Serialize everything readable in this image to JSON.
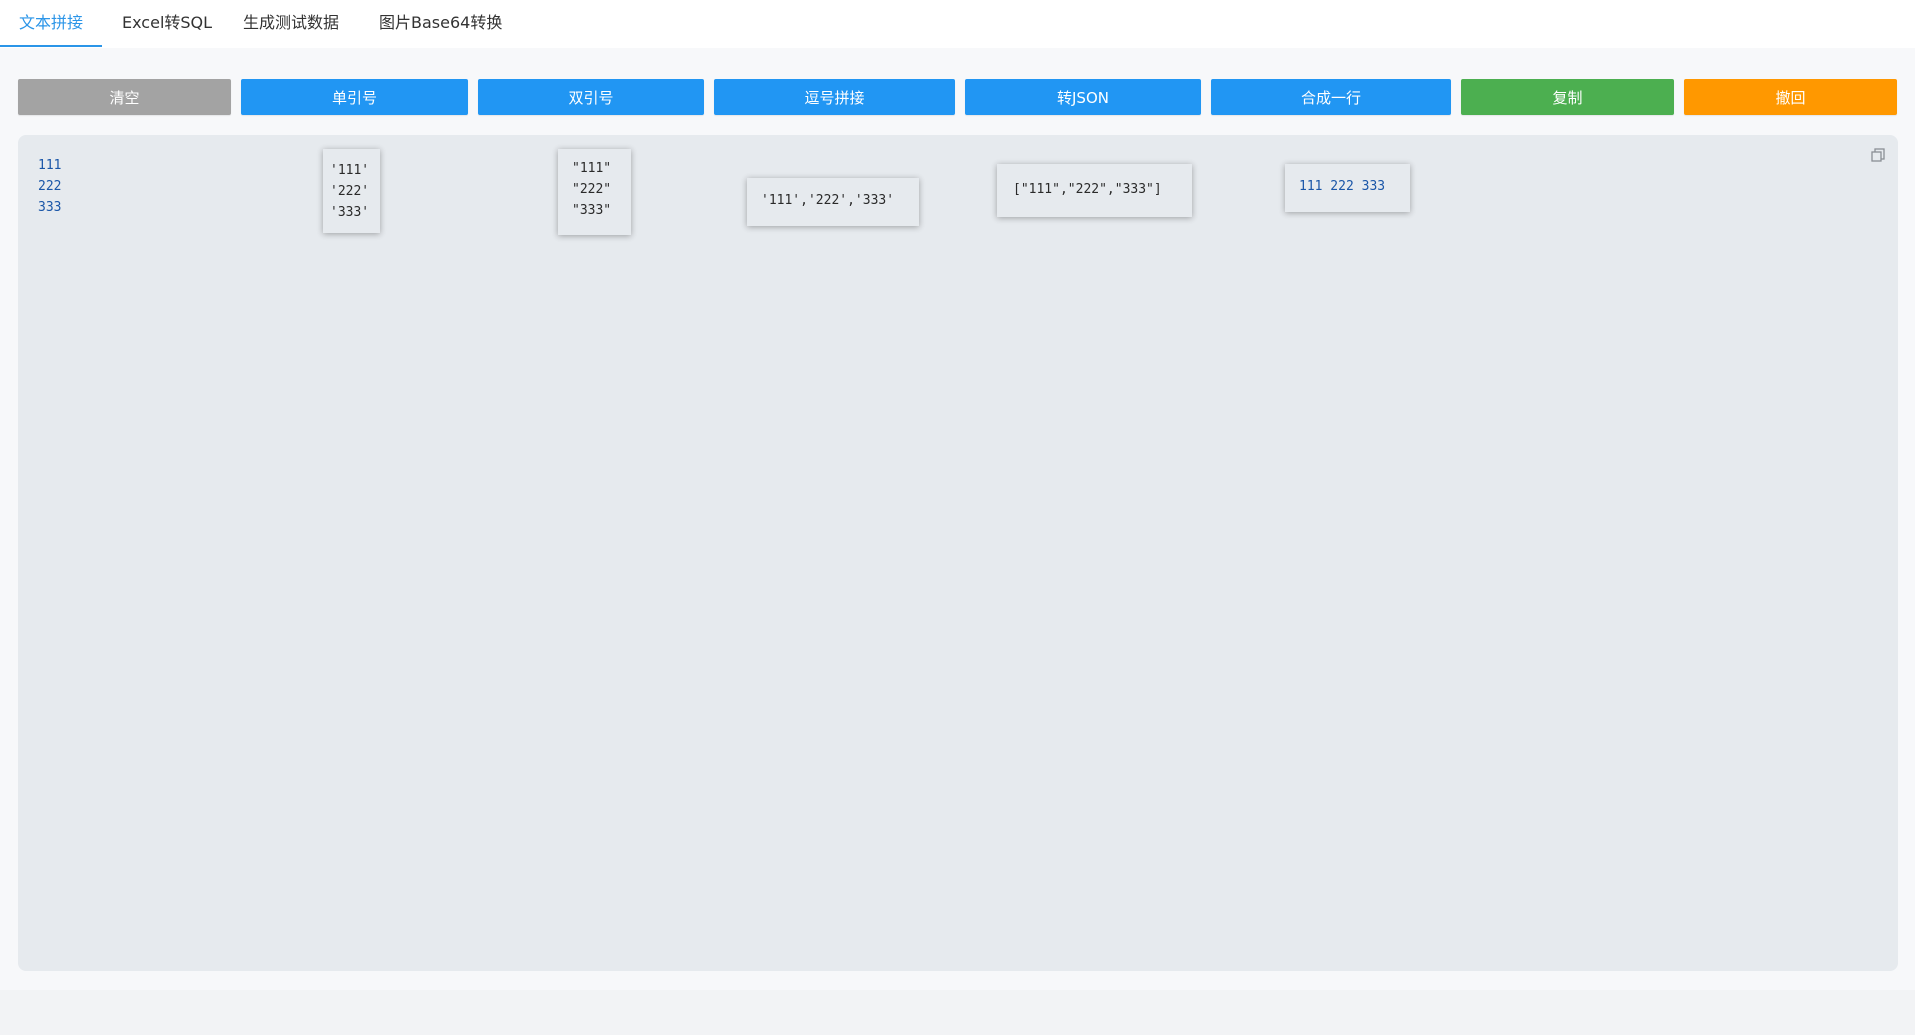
{
  "tabs": [
    {
      "label": "文本拼接",
      "active": true
    },
    {
      "label": "Excel转SQL",
      "active": false
    },
    {
      "label": "生成测试数据",
      "active": false
    },
    {
      "label": "图片Base64转换",
      "active": false
    }
  ],
  "toolbar": {
    "clear_label": "清空",
    "single_quote_label": "单引号",
    "double_quote_label": "双引号",
    "comma_join_label": "逗号拼接",
    "to_json_label": "转JSON",
    "merge_line_label": "合成一行",
    "copy_label": "复制",
    "undo_label": "撤回"
  },
  "colors": {
    "accent": "#2b95e8",
    "clear": "#a3a3a3",
    "primary": "#2196f3",
    "copy": "#4caf50",
    "undo": "#ff9800"
  },
  "editor": {
    "input_text": "111\n222\n333",
    "copy_icon": "copy-icon"
  },
  "results": {
    "single_quote": "'111'\n'222'\n'333'",
    "double_quote": "\"111\"\n\"222\"\n\"333\"",
    "comma_join": "'111','222','333'",
    "to_json": "[\"111\",\"222\",\"333\"]",
    "merge_line": "111 222 333"
  }
}
